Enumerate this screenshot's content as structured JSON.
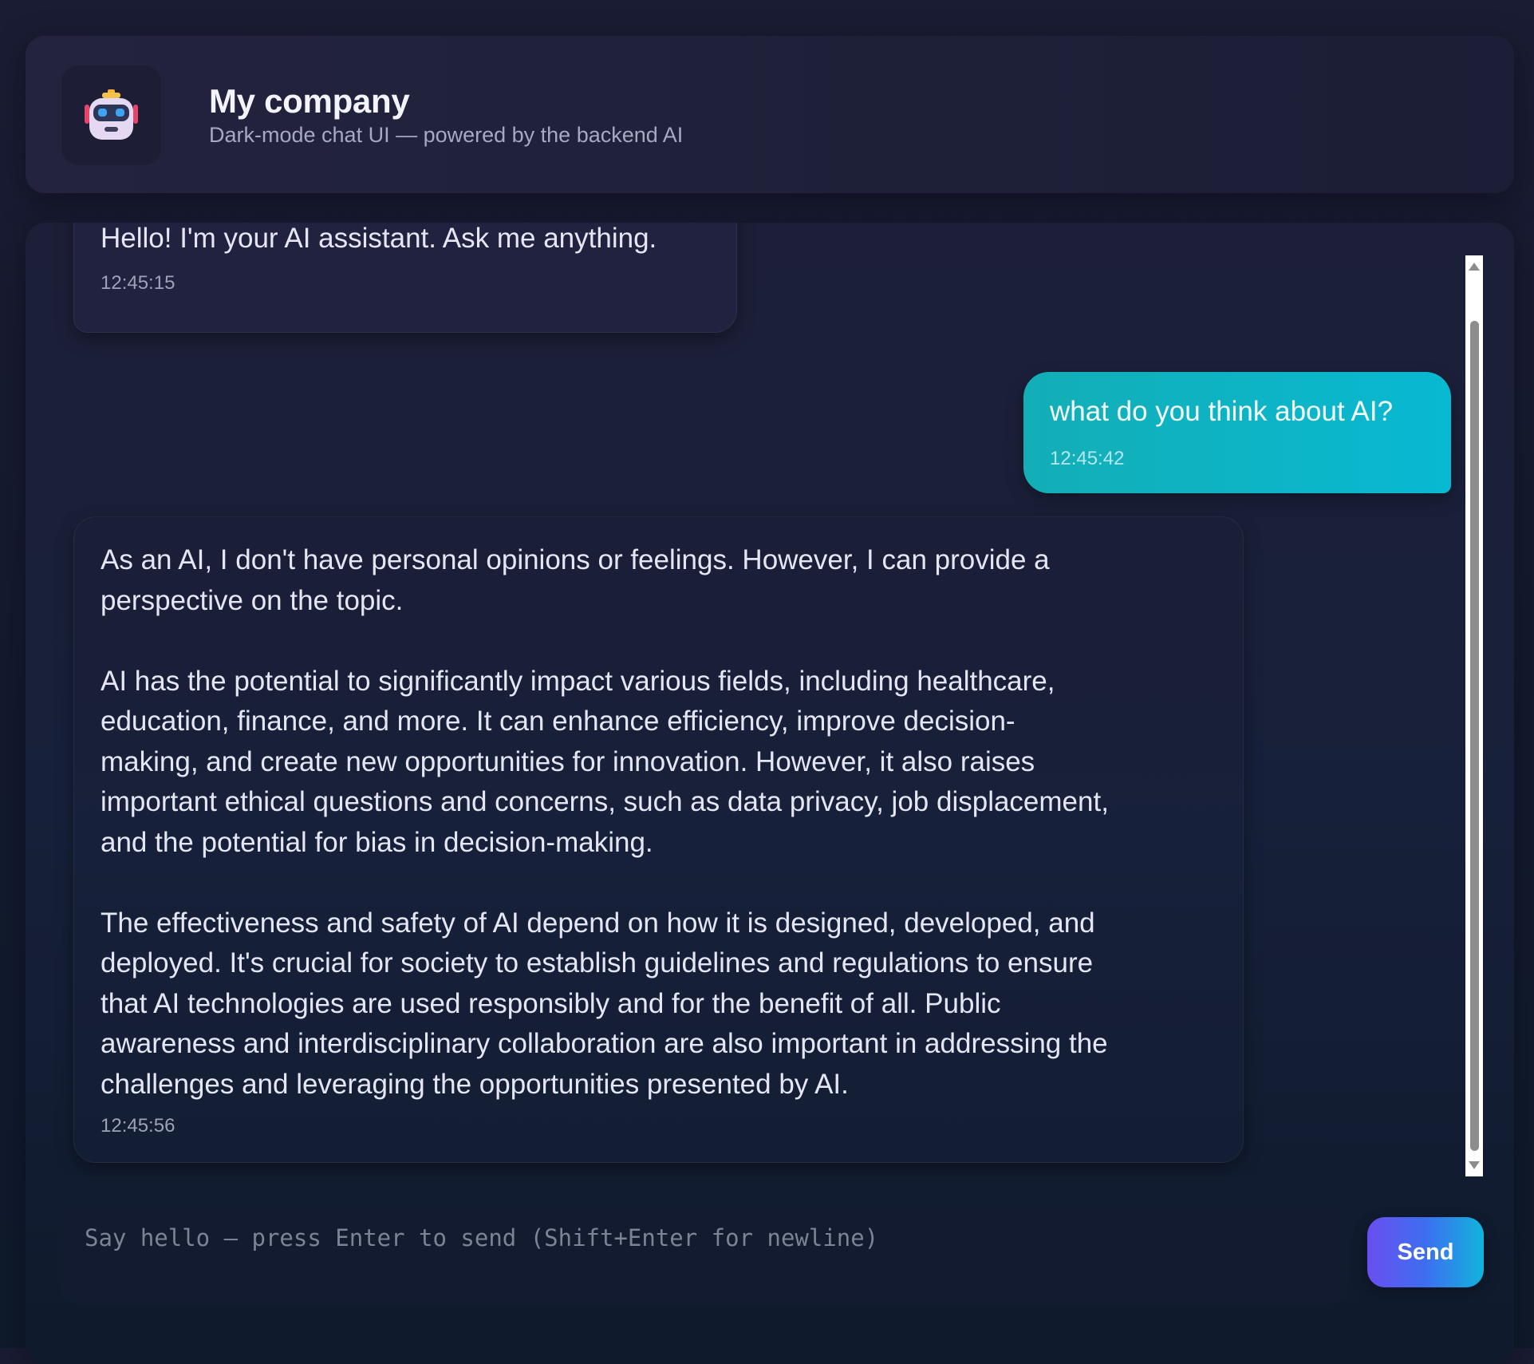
{
  "header": {
    "logo_icon": "robot-icon",
    "title": "My company",
    "subtitle": "Dark-mode chat UI — powered by the backend AI"
  },
  "messages": [
    {
      "role": "assistant",
      "text": "Hello! I'm your AI assistant. Ask me anything.",
      "time": "12:45:15"
    },
    {
      "role": "user",
      "text": "what do you think about AI?",
      "time": "12:45:42"
    },
    {
      "role": "assistant",
      "text": "As an AI, I don't have personal opinions or feelings. However, I can provide a\nperspective on the topic.\n\nAI has the potential to significantly impact various fields, including healthcare,\neducation, finance, and more. It can enhance efficiency, improve decision-\nmaking, and create new opportunities for innovation. However, it also raises\nimportant ethical questions and concerns, such as data privacy, job displacement,\nand the potential for bias in decision-making.\n\nThe effectiveness and safety of AI depend on how it is designed, developed, and\ndeployed. It's crucial for society to establish guidelines and regulations to ensure\nthat AI technologies are used responsibly and for the benefit of all. Public\nawareness and interdisciplinary collaboration are also important in addressing the\nchallenges and leveraging the opportunities presented by AI.",
      "time": "12:45:56"
    }
  ],
  "composer": {
    "placeholder": "Say hello — press Enter to send (Shift+Enter for newline)",
    "value": "",
    "send_label": "Send"
  },
  "colors": {
    "background": "#161b30",
    "user_bubble": "#08b9d2",
    "assistant_bubble": "#1c1f38",
    "send_gradient_start": "#6a4ef0",
    "send_gradient_end": "#10b4dc"
  }
}
